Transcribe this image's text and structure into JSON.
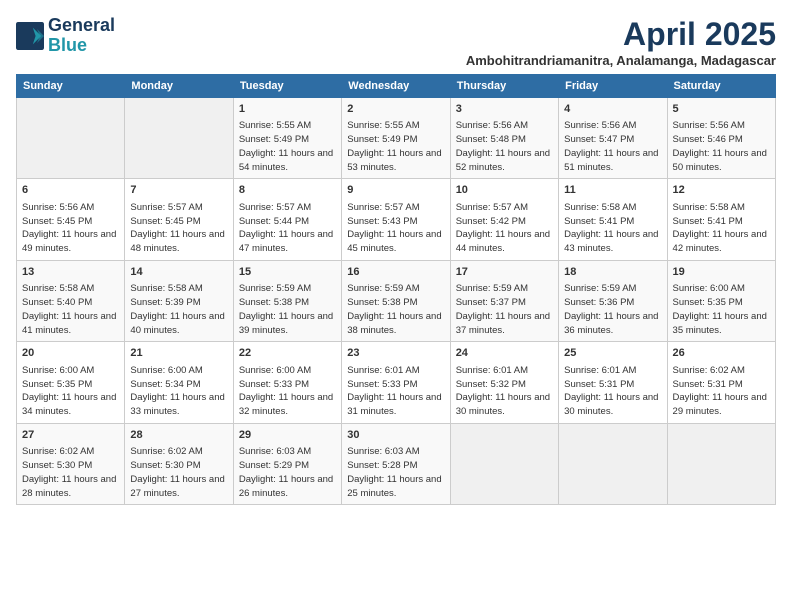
{
  "logo": {
    "line1": "General",
    "line2": "Blue"
  },
  "title": "April 2025",
  "subtitle": "Ambohitrandriamanitra, Analamanga, Madagascar",
  "days_of_week": [
    "Sunday",
    "Monday",
    "Tuesday",
    "Wednesday",
    "Thursday",
    "Friday",
    "Saturday"
  ],
  "weeks": [
    [
      {
        "day": "",
        "sunrise": "",
        "sunset": "",
        "daylight": ""
      },
      {
        "day": "",
        "sunrise": "",
        "sunset": "",
        "daylight": ""
      },
      {
        "day": "1",
        "sunrise": "Sunrise: 5:55 AM",
        "sunset": "Sunset: 5:49 PM",
        "daylight": "Daylight: 11 hours and 54 minutes."
      },
      {
        "day": "2",
        "sunrise": "Sunrise: 5:55 AM",
        "sunset": "Sunset: 5:49 PM",
        "daylight": "Daylight: 11 hours and 53 minutes."
      },
      {
        "day": "3",
        "sunrise": "Sunrise: 5:56 AM",
        "sunset": "Sunset: 5:48 PM",
        "daylight": "Daylight: 11 hours and 52 minutes."
      },
      {
        "day": "4",
        "sunrise": "Sunrise: 5:56 AM",
        "sunset": "Sunset: 5:47 PM",
        "daylight": "Daylight: 11 hours and 51 minutes."
      },
      {
        "day": "5",
        "sunrise": "Sunrise: 5:56 AM",
        "sunset": "Sunset: 5:46 PM",
        "daylight": "Daylight: 11 hours and 50 minutes."
      }
    ],
    [
      {
        "day": "6",
        "sunrise": "Sunrise: 5:56 AM",
        "sunset": "Sunset: 5:45 PM",
        "daylight": "Daylight: 11 hours and 49 minutes."
      },
      {
        "day": "7",
        "sunrise": "Sunrise: 5:57 AM",
        "sunset": "Sunset: 5:45 PM",
        "daylight": "Daylight: 11 hours and 48 minutes."
      },
      {
        "day": "8",
        "sunrise": "Sunrise: 5:57 AM",
        "sunset": "Sunset: 5:44 PM",
        "daylight": "Daylight: 11 hours and 47 minutes."
      },
      {
        "day": "9",
        "sunrise": "Sunrise: 5:57 AM",
        "sunset": "Sunset: 5:43 PM",
        "daylight": "Daylight: 11 hours and 45 minutes."
      },
      {
        "day": "10",
        "sunrise": "Sunrise: 5:57 AM",
        "sunset": "Sunset: 5:42 PM",
        "daylight": "Daylight: 11 hours and 44 minutes."
      },
      {
        "day": "11",
        "sunrise": "Sunrise: 5:58 AM",
        "sunset": "Sunset: 5:41 PM",
        "daylight": "Daylight: 11 hours and 43 minutes."
      },
      {
        "day": "12",
        "sunrise": "Sunrise: 5:58 AM",
        "sunset": "Sunset: 5:41 PM",
        "daylight": "Daylight: 11 hours and 42 minutes."
      }
    ],
    [
      {
        "day": "13",
        "sunrise": "Sunrise: 5:58 AM",
        "sunset": "Sunset: 5:40 PM",
        "daylight": "Daylight: 11 hours and 41 minutes."
      },
      {
        "day": "14",
        "sunrise": "Sunrise: 5:58 AM",
        "sunset": "Sunset: 5:39 PM",
        "daylight": "Daylight: 11 hours and 40 minutes."
      },
      {
        "day": "15",
        "sunrise": "Sunrise: 5:59 AM",
        "sunset": "Sunset: 5:38 PM",
        "daylight": "Daylight: 11 hours and 39 minutes."
      },
      {
        "day": "16",
        "sunrise": "Sunrise: 5:59 AM",
        "sunset": "Sunset: 5:38 PM",
        "daylight": "Daylight: 11 hours and 38 minutes."
      },
      {
        "day": "17",
        "sunrise": "Sunrise: 5:59 AM",
        "sunset": "Sunset: 5:37 PM",
        "daylight": "Daylight: 11 hours and 37 minutes."
      },
      {
        "day": "18",
        "sunrise": "Sunrise: 5:59 AM",
        "sunset": "Sunset: 5:36 PM",
        "daylight": "Daylight: 11 hours and 36 minutes."
      },
      {
        "day": "19",
        "sunrise": "Sunrise: 6:00 AM",
        "sunset": "Sunset: 5:35 PM",
        "daylight": "Daylight: 11 hours and 35 minutes."
      }
    ],
    [
      {
        "day": "20",
        "sunrise": "Sunrise: 6:00 AM",
        "sunset": "Sunset: 5:35 PM",
        "daylight": "Daylight: 11 hours and 34 minutes."
      },
      {
        "day": "21",
        "sunrise": "Sunrise: 6:00 AM",
        "sunset": "Sunset: 5:34 PM",
        "daylight": "Daylight: 11 hours and 33 minutes."
      },
      {
        "day": "22",
        "sunrise": "Sunrise: 6:00 AM",
        "sunset": "Sunset: 5:33 PM",
        "daylight": "Daylight: 11 hours and 32 minutes."
      },
      {
        "day": "23",
        "sunrise": "Sunrise: 6:01 AM",
        "sunset": "Sunset: 5:33 PM",
        "daylight": "Daylight: 11 hours and 31 minutes."
      },
      {
        "day": "24",
        "sunrise": "Sunrise: 6:01 AM",
        "sunset": "Sunset: 5:32 PM",
        "daylight": "Daylight: 11 hours and 30 minutes."
      },
      {
        "day": "25",
        "sunrise": "Sunrise: 6:01 AM",
        "sunset": "Sunset: 5:31 PM",
        "daylight": "Daylight: 11 hours and 30 minutes."
      },
      {
        "day": "26",
        "sunrise": "Sunrise: 6:02 AM",
        "sunset": "Sunset: 5:31 PM",
        "daylight": "Daylight: 11 hours and 29 minutes."
      }
    ],
    [
      {
        "day": "27",
        "sunrise": "Sunrise: 6:02 AM",
        "sunset": "Sunset: 5:30 PM",
        "daylight": "Daylight: 11 hours and 28 minutes."
      },
      {
        "day": "28",
        "sunrise": "Sunrise: 6:02 AM",
        "sunset": "Sunset: 5:30 PM",
        "daylight": "Daylight: 11 hours and 27 minutes."
      },
      {
        "day": "29",
        "sunrise": "Sunrise: 6:03 AM",
        "sunset": "Sunset: 5:29 PM",
        "daylight": "Daylight: 11 hours and 26 minutes."
      },
      {
        "day": "30",
        "sunrise": "Sunrise: 6:03 AM",
        "sunset": "Sunset: 5:28 PM",
        "daylight": "Daylight: 11 hours and 25 minutes."
      },
      {
        "day": "",
        "sunrise": "",
        "sunset": "",
        "daylight": ""
      },
      {
        "day": "",
        "sunrise": "",
        "sunset": "",
        "daylight": ""
      },
      {
        "day": "",
        "sunrise": "",
        "sunset": "",
        "daylight": ""
      }
    ]
  ]
}
